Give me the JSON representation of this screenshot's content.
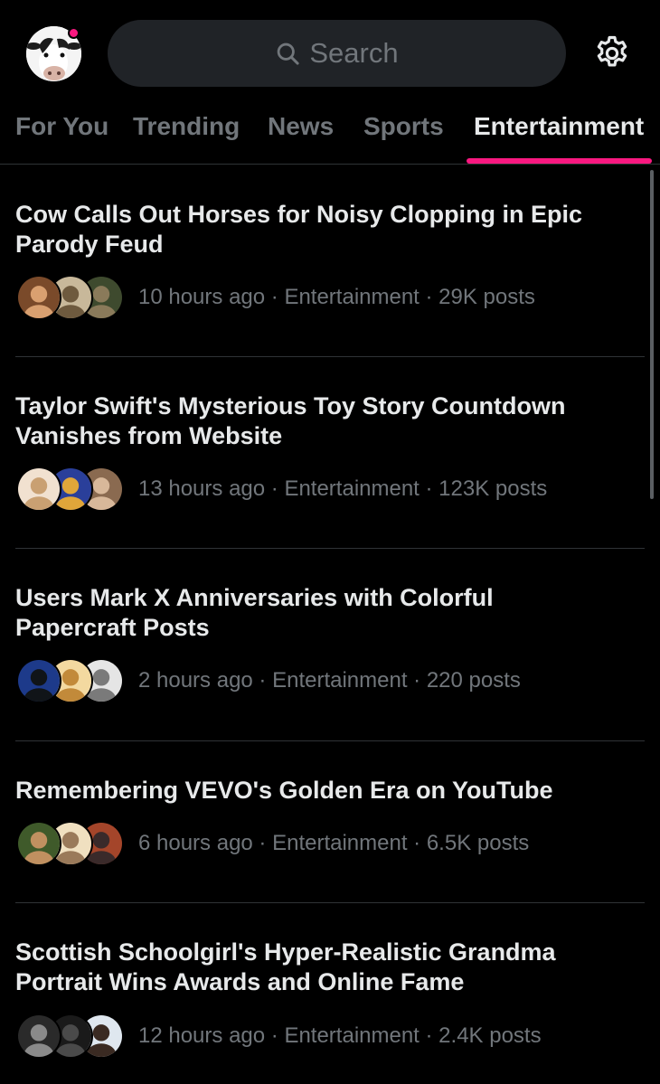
{
  "header": {
    "search_placeholder": "Search",
    "has_notification": true,
    "icons": {
      "avatar": "cow-avatar",
      "search": "search-icon",
      "settings": "gear-icon"
    }
  },
  "tabs": [
    {
      "label": "For You",
      "active": false
    },
    {
      "label": "Trending",
      "active": false
    },
    {
      "label": "News",
      "active": false
    },
    {
      "label": "Sports",
      "active": false
    },
    {
      "label": "Entertainment",
      "active": true
    }
  ],
  "colors": {
    "accent": "#f91880",
    "text_primary": "#e7e9ea",
    "text_secondary": "#71767b",
    "divider": "#2f3336",
    "background": "#000000"
  },
  "items": [
    {
      "title": "Cow Calls Out Horses for Noisy Clopping in Epic Parody Feud",
      "meta": "10 hours ago · Entertainment · 29K posts",
      "avatar_colors": [
        [
          "#7a4a2a",
          "#d9a070"
        ],
        [
          "#c8b89a",
          "#6e5a3e"
        ],
        [
          "#3e4a2e",
          "#8a7a5a"
        ]
      ]
    },
    {
      "title": "Taylor Swift's Mysterious Toy Story Countdown Vanishes from Website",
      "meta": "13 hours ago · Entertainment · 123K posts",
      "avatar_colors": [
        [
          "#f1e1d0",
          "#c9a072"
        ],
        [
          "#2a3f9a",
          "#e0a63a"
        ],
        [
          "#8a6a50",
          "#d8b89a"
        ]
      ]
    },
    {
      "title": "Users Mark X Anniversaries with Colorful Papercraft Posts",
      "meta": "2 hours ago · Entertainment · 220 posts",
      "avatar_colors": [
        [
          "#1d3a8a",
          "#101418"
        ],
        [
          "#f3d9a0",
          "#c28a3a"
        ],
        [
          "#e5e5e5",
          "#7a7a7a"
        ]
      ]
    },
    {
      "title": "Remembering VEVO's Golden Era on YouTube",
      "meta": "6 hours ago · Entertainment · 6.5K posts",
      "avatar_colors": [
        [
          "#3f5a2a",
          "#c09060"
        ],
        [
          "#f0e0c0",
          "#9a7a5a"
        ],
        [
          "#a4452a",
          "#3a2a2a"
        ]
      ]
    },
    {
      "title": "Scottish Schoolgirl's Hyper-Realistic Grandma Portrait Wins Awards and Online Fame",
      "meta": "12 hours ago · Entertainment · 2.4K posts",
      "avatar_colors": [
        [
          "#2a2a2a",
          "#8a8a8a"
        ],
        [
          "#1a1a1a",
          "#4a4a4a"
        ],
        [
          "#dfe7ef",
          "#3a2a22"
        ]
      ]
    }
  ]
}
